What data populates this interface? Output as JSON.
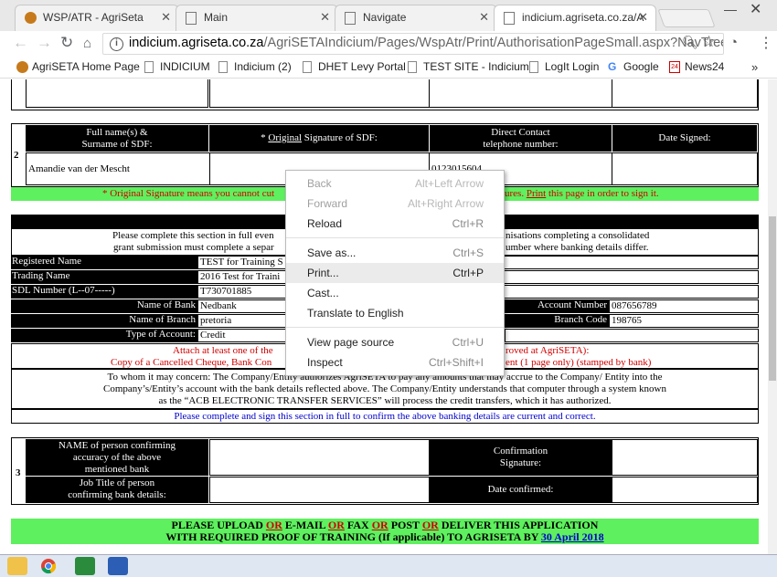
{
  "tabs": [
    {
      "label": "WSP/ATR - AgriSeta"
    },
    {
      "label": "Main"
    },
    {
      "label": "Navigate"
    },
    {
      "label": "indicium.agriseta.co.za/A"
    }
  ],
  "address": {
    "host": "indicium.agriseta.co.za",
    "path": "/AgriSETAIndicium/Pages/WspAtr/Print/AuthorisationPageSmall.aspx?NavTree=2..."
  },
  "bookmarks": [
    {
      "label": "AgriSETA Home Page"
    },
    {
      "label": "INDICIUM"
    },
    {
      "label": "Indicium (2)"
    },
    {
      "label": "DHET Levy Portal"
    },
    {
      "label": "TEST SITE - Indicium"
    },
    {
      "label": "LogIt Login"
    },
    {
      "label": "Google"
    },
    {
      "label": "News24"
    }
  ],
  "section2": {
    "number": "2",
    "h_fullname_1": "Full name(s) &",
    "h_fullname_2": "Surname of SDF:",
    "h_sig_star": "* ",
    "h_sig_original": "Original",
    "h_sig_rest": " Signature of SDF:",
    "h_phone_1": "Direct Contact",
    "h_phone_2": "telephone number:",
    "h_date": "Date Signed:",
    "name": "Amandie van der Mescht",
    "phone": "0123015604",
    "note_left": "* Original Signature means you cannot cut",
    "note_right_a": "ures. ",
    "note_print": "Print",
    "note_right_b": " this page in order to sign it."
  },
  "bank": {
    "intro_1a": "Please complete this section in full even",
    "intro_1b": "nisations completing a consolidated",
    "intro_2a": "grant submission must complete a separ",
    "intro_2b": "umber where banking details differ.",
    "reg_label": "Registered Name",
    "reg_value": "TEST for Training S",
    "trading_label": "Trading Name",
    "trading_value": "2016 Test for Traini",
    "sdl_label": "SDL Number (L--07-----)",
    "sdl_value": "T730701885",
    "bank_label": "Name of Bank",
    "bank_value": "Nedbank",
    "branch_label": "Name of Branch",
    "branch_value": "pretoria",
    "type_label": "Type of Account:",
    "type_value": "Credit",
    "acc_label": "Account Number",
    "acc_value": "087656789",
    "code_label": "Branch Code",
    "code_value": "198765",
    "attach_1a": "Attach at least one of the",
    "attach_1b": "roved at AgriSETA):",
    "attach_2a": "Copy of a Cancelled Cheque, Bank Con",
    "attach_2b": "ent (1 page only) (stamped by bank)",
    "concern_1": "To whom it may concern: The Company/Entity authorizes AgriSETA to pay any amounts that may accrue to the Company/ Entity into the",
    "concern_2": "Company’s/Entity’s account with the bank details reflected above. The Company/Entity understands that computer through a system known",
    "concern_3": "as the “ACB ELECTRONIC TRANSFER SERVICES” will process the credit transfers, which it has authorized.",
    "confirm_note": "Please complete and sign this section in full to confirm the above banking details are current and correct."
  },
  "section3": {
    "number": "3",
    "name_1": "NAME of person confirming",
    "name_2": "accuracy of the above",
    "name_3": "mentioned bank",
    "job_1": "Job Title of person",
    "job_2": "confirming bank details:",
    "sig_1": "Confirmation",
    "sig_2": "Signature:",
    "date": "Date confirmed:"
  },
  "footer": {
    "l1_a": "PLEASE UPLOAD ",
    "l1_or1": "OR",
    "l1_b": " E-MAIL ",
    "l1_or2": "OR",
    "l1_c": " FAX ",
    "l1_or3": "OR",
    "l1_d": " POST ",
    "l1_or4": "OR",
    "l1_e": " DELIVER THIS APPLICATION",
    "l2": "WITH REQUIRED PROOF OF TRAINING (If applicable) TO AGRISETA BY ",
    "l2_date": "30 April 2018"
  },
  "context_menu": [
    {
      "label": "Back",
      "shortcut": "Alt+Left Arrow",
      "enabled": false
    },
    {
      "label": "Forward",
      "shortcut": "Alt+Right Arrow",
      "enabled": false
    },
    {
      "label": "Reload",
      "shortcut": "Ctrl+R",
      "enabled": true
    },
    {
      "label": "Save as...",
      "shortcut": "Ctrl+S",
      "enabled": true
    },
    {
      "label": "Print...",
      "shortcut": "Ctrl+P",
      "enabled": true
    },
    {
      "label": "Cast...",
      "shortcut": "",
      "enabled": true
    },
    {
      "label": "Translate to English",
      "shortcut": "",
      "enabled": true
    },
    {
      "label": "View page source",
      "shortcut": "Ctrl+U",
      "enabled": true
    },
    {
      "label": "Inspect",
      "shortcut": "Ctrl+Shift+I",
      "enabled": true
    }
  ],
  "colors": {
    "green_band": "#5ef05e",
    "red_text": "#d00000",
    "blue_text": "#0000cc"
  }
}
